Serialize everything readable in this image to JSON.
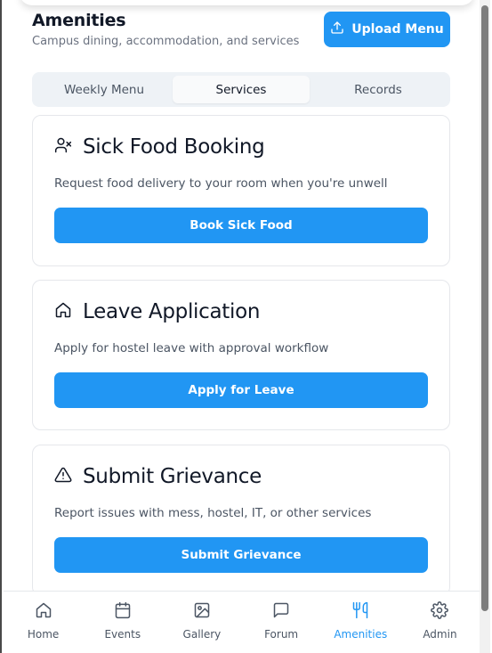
{
  "header": {
    "title": "Amenities",
    "subtitle": "Campus dining, accommodation, and services",
    "upload_label": "Upload Menu"
  },
  "tabs": [
    {
      "label": "Weekly Menu",
      "active": false
    },
    {
      "label": "Services",
      "active": true
    },
    {
      "label": "Records",
      "active": false
    }
  ],
  "cards": [
    {
      "icon": "user-x-icon",
      "title": "Sick Food Booking",
      "description": "Request food delivery to your room when you're unwell",
      "button": "Book Sick Food"
    },
    {
      "icon": "home-icon",
      "title": "Leave Application",
      "description": "Apply for hostel leave with approval workflow",
      "button": "Apply for Leave"
    },
    {
      "icon": "alert-triangle-icon",
      "title": "Submit Grievance",
      "description": "Report issues with mess, hostel, IT, or other services",
      "button": "Submit Grievance"
    }
  ],
  "nav": [
    {
      "label": "Home",
      "icon": "home-icon",
      "active": false
    },
    {
      "label": "Events",
      "icon": "calendar-icon",
      "active": false
    },
    {
      "label": "Gallery",
      "icon": "image-icon",
      "active": false
    },
    {
      "label": "Forum",
      "icon": "message-square-icon",
      "active": false
    },
    {
      "label": "Amenities",
      "icon": "utensils-icon",
      "active": true
    },
    {
      "label": "Admin",
      "icon": "settings-icon",
      "active": false
    }
  ],
  "colors": {
    "primary": "#2196f3",
    "tab_bg": "#eef2f6",
    "text_muted": "#6b7280"
  }
}
